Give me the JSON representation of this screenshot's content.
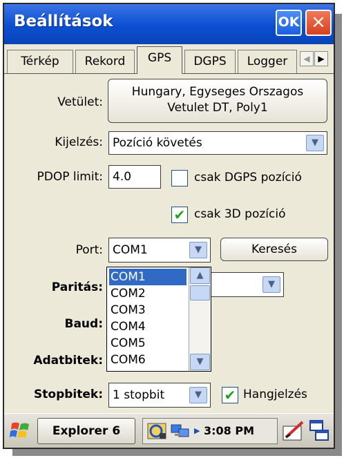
{
  "window": {
    "title": "Beállítások",
    "ok_label": "OK",
    "close_label": "×"
  },
  "tabs": [
    {
      "label": "Térkép"
    },
    {
      "label": "Rekord"
    },
    {
      "label": "GPS",
      "active": true
    },
    {
      "label": "DGPS"
    },
    {
      "label": "Logger"
    }
  ],
  "tab_scroll": {
    "left": "◀",
    "right": "▶"
  },
  "form": {
    "vetulet_label": "Vetület:",
    "vetulet_button_line1": "Hungary, Egyseges Orszagos",
    "vetulet_button_line2": "Vetulet DT, Poly1",
    "kijelzes_label": "Kijelzés:",
    "kijelzes_value": "Pozíció követés",
    "pdop_label": "PDOP limit:",
    "pdop_value": "4.0",
    "csak_dgps_label": "csak DGPS pozíció",
    "csak_dgps_checked": false,
    "csak_3d_label": "csak 3D pozíció",
    "csak_3d_checked": true,
    "port_label": "Port:",
    "port_value": "COM1",
    "kereses_label": "Keresés",
    "paritas_label": "Paritás:",
    "baud_label": "Baud:",
    "adatbitek_label": "Adatbitek:",
    "stopbitek_label": "Stopbitek:",
    "stopbitek_value": "1 stopbit",
    "hangjelzes_label": "Hangjelzés",
    "hangjelzes_checked": true
  },
  "port_dropdown": {
    "items": [
      "COM1",
      "COM2",
      "COM3",
      "COM4",
      "COM5",
      "COM6"
    ],
    "selected": "COM1"
  },
  "glyphs": {
    "dropdown_arrow": "▼",
    "scroll_up": "▲",
    "scroll_down": "▼",
    "check": "✔"
  },
  "taskbar": {
    "app_button": "Explorer 6",
    "clock": "3:08 PM"
  },
  "colors": {
    "titlebar": "#0a4fd1",
    "selection": "#316ac5",
    "check_green": "#21a121"
  }
}
